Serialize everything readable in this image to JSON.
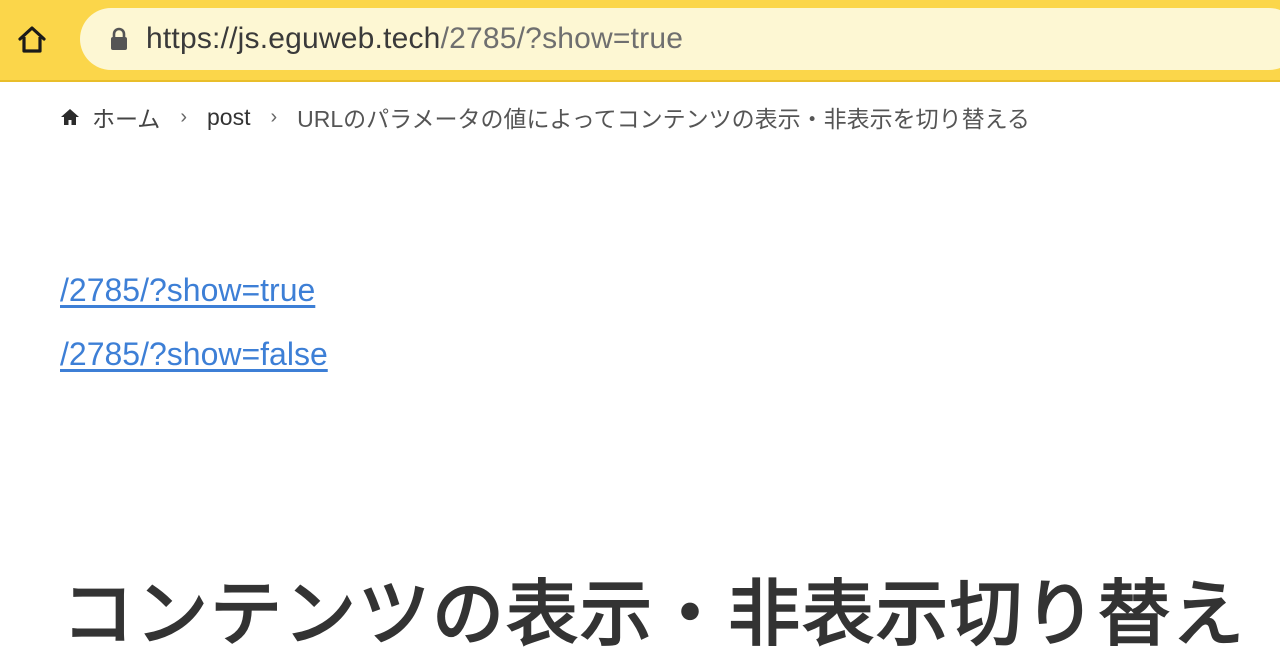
{
  "browser": {
    "url_host": "https://js.eguweb.tech",
    "url_path": "/2785/?show=true",
    "accent_color": "#fbd64a"
  },
  "breadcrumb": {
    "home_label": "ホーム",
    "separator": "›",
    "items": [
      {
        "label": "post"
      },
      {
        "label": "URLのパラメータの値によってコンテンツの表示・非表示を切り替える"
      }
    ]
  },
  "links": [
    {
      "label": "/2785/?show=true"
    },
    {
      "label": "/2785/?show=false"
    }
  ],
  "heading": "コンテンツの表示・非表示切り替え"
}
